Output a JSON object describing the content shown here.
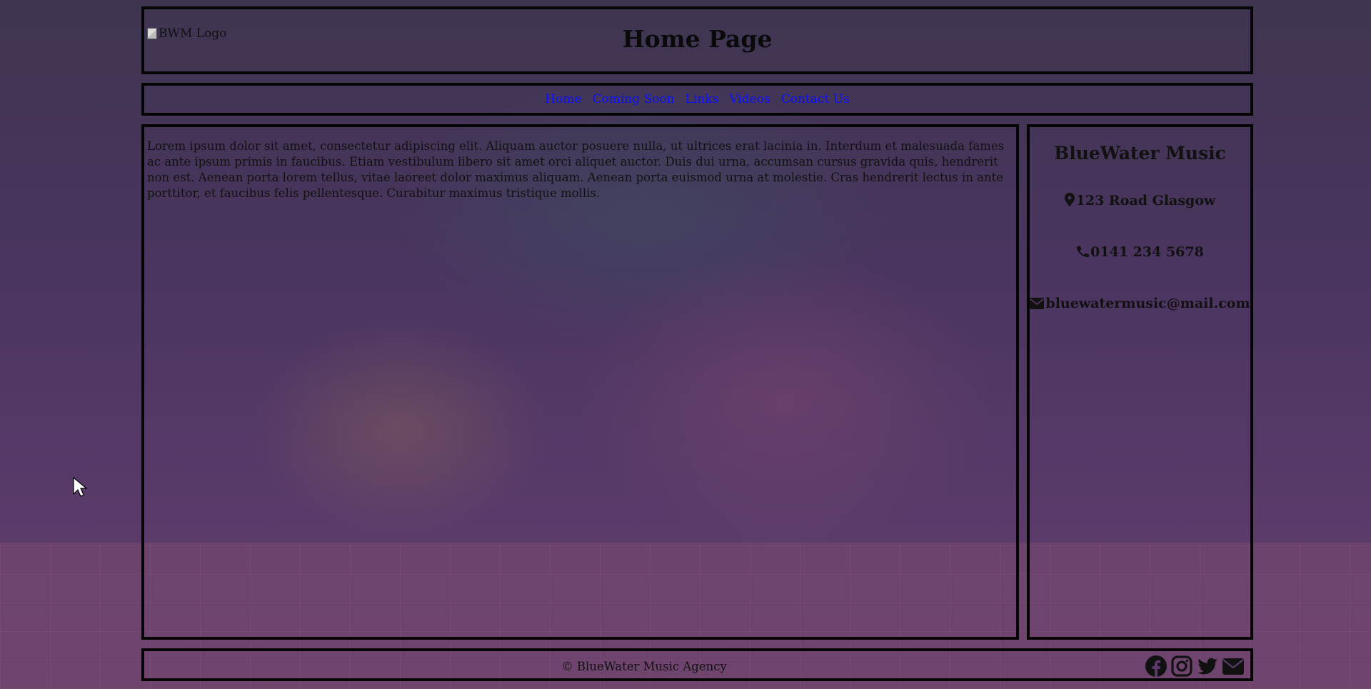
{
  "header": {
    "logo_alt": "BWM Logo",
    "title": "Home Page"
  },
  "nav": {
    "items": [
      {
        "label": "Home"
      },
      {
        "label": "Coming Soon"
      },
      {
        "label": "Links"
      },
      {
        "label": "Videos"
      },
      {
        "label": "Contact Us"
      }
    ]
  },
  "main": {
    "body_text": "Lorem ipsum dolor sit amet, consectetur adipiscing elit. Aliquam auctor posuere nulla, ut ultrices erat lacinia in. Interdum et malesuada fames ac ante ipsum primis in faucibus. Etiam vestibulum libero sit amet orci aliquet auctor. Duis dui urna, accumsan cursus gravida quis, hendrerit non est. Aenean porta lorem tellus, vitae laoreet dolor maximus aliquam. Aenean porta euismod urna at molestie. Cras hendrerit lectus in ante porttitor, et faucibus felis pellentesque. Curabitur maximus tristique mollis."
  },
  "aside": {
    "title": "BlueWater Music",
    "address": "123 Road Glasgow",
    "phone": "0141 234 5678",
    "email": "bluewatermusic@mail.com"
  },
  "footer": {
    "copyright": "© BlueWater Music Agency",
    "social_icons": [
      "facebook-icon",
      "instagram-icon",
      "twitter-icon",
      "envelope-icon"
    ]
  },
  "colors": {
    "link": "#0a10ff",
    "border": "#050505",
    "overlay": "#4a3560"
  }
}
